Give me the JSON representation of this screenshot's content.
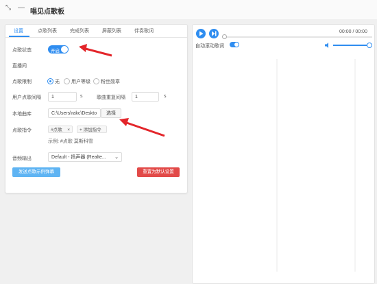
{
  "app": {
    "title": "唱见点歌板",
    "pin_icon": "pin-icon",
    "minimize_icon": "minimize-icon"
  },
  "tabs": [
    "设置",
    "点歌列表",
    "完成列表",
    "屏蔽列表",
    "伴奏歌词"
  ],
  "settings": {
    "song_status_label": "点歌状态",
    "song_status_toggle": "开启",
    "live_room_label": "直播间",
    "limit_label": "点歌限制",
    "limit_options": [
      "无",
      "用户等级",
      "粉丝勋章"
    ],
    "user_interval_label": "用户点歌间隔",
    "user_interval_value": "1",
    "user_interval_unit": "s",
    "repeat_interval_label": "歌曲重复间隔",
    "repeat_interval_value": "1",
    "repeat_interval_unit": "s",
    "library_label": "本地曲库",
    "library_path": "C:\\Users\\rakc\\Deskto",
    "library_choose": "选择",
    "command_label": "点歌指令",
    "command_tag": "#点歌",
    "command_tag_close": "×",
    "add_command": "+ 添加指令",
    "command_example": "示例: #点歌 莫斯科雪",
    "audio_output_label": "音频输出",
    "audio_output_value": "Default - 扬声器 (Realte...",
    "send_example_button": "发送点歌示例弹幕",
    "reset_button": "重置为默认设置"
  },
  "player": {
    "time": "00:00 / 00:00",
    "auto_scroll_label": "自动滚动歌词",
    "progress": 0,
    "volume": 1.0
  },
  "colors": {
    "accent": "#2f8df0",
    "danger": "#e24a48",
    "annotation_arrow": "#e3252a"
  }
}
